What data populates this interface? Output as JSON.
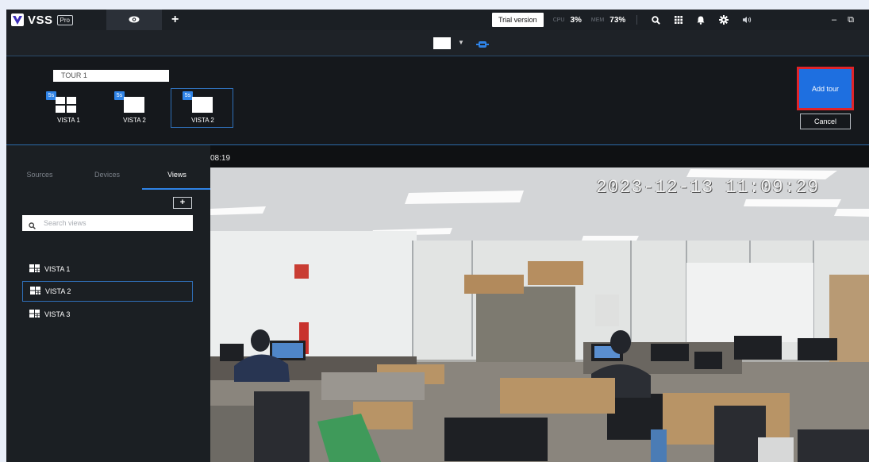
{
  "app": {
    "logo_text": "VSS",
    "pro_badge": "Pro",
    "icons": {
      "live_view_tab": "eye-icon",
      "add_tab": "plus-icon",
      "search": "search-icon",
      "grid": "grid-icon",
      "notifications": "bell-icon",
      "settings": "gear-icon",
      "audio": "speaker-icon"
    }
  },
  "topbar": {
    "add_tab": "+",
    "trial_label": "Trial version",
    "cpu_label": "CPU",
    "cpu_value": "3%",
    "mem_label": "MEM",
    "mem_value": "73%",
    "minimize": "–",
    "restore": "⧉"
  },
  "subbar": {
    "layout_caret": "▼"
  },
  "tour": {
    "name_value": "TOUR 1",
    "items": [
      {
        "seconds": "5s",
        "label": "VISTA 1",
        "layout": "quad",
        "selected": false
      },
      {
        "seconds": "5s",
        "label": "VISTA 2",
        "layout": "single",
        "selected": false
      },
      {
        "seconds": "5s",
        "label": "VISTA 2",
        "layout": "single",
        "selected": true
      }
    ],
    "add_button": "Add tour",
    "cancel_button": "Cancel"
  },
  "sidebar": {
    "tabs": [
      {
        "label": "Sources",
        "active": false
      },
      {
        "label": "Devices",
        "active": false
      },
      {
        "label": "Views",
        "active": true
      }
    ],
    "add_button": "+",
    "search_placeholder": "Search views",
    "views": [
      {
        "label": "VISTA 1",
        "selected": false
      },
      {
        "label": "VISTA 2",
        "selected": true
      },
      {
        "label": "VISTA 3",
        "selected": false
      }
    ]
  },
  "camera": {
    "header_time": "08:19",
    "osd_timestamp": "2023-12-13 11:09:29"
  },
  "colors": {
    "accent": "#2f83e6",
    "add_tour_bg": "#1e6fe0",
    "highlight_border": "#e0242a",
    "panel_bg": "#15181c"
  }
}
